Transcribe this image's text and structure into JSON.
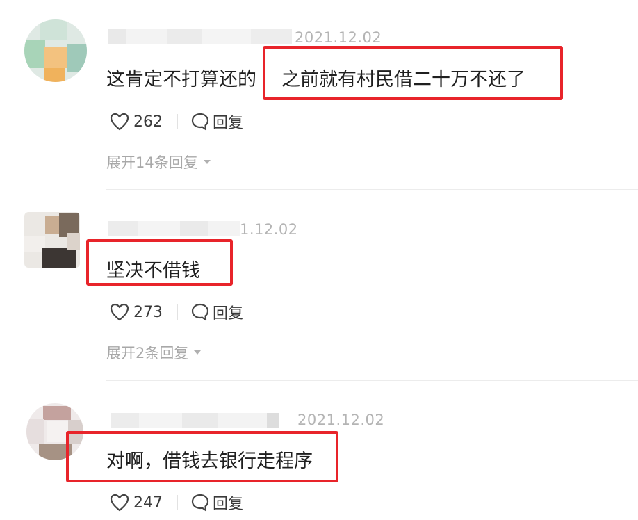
{
  "comments": [
    {
      "timestamp": "2021.12.02",
      "text_before": "这肯定不打算还的",
      "text_highlight": "之前就有村民借二十万不还了",
      "like_count": "262",
      "reply_label": "回复",
      "expand_label": "展开14条回复"
    },
    {
      "timestamp": "1.12.02",
      "text_highlight": "坚决不借钱",
      "like_count": "273",
      "reply_label": "回复",
      "expand_label": "展开2条回复"
    },
    {
      "timestamp": "2021.12.02",
      "text_highlight": "对啊，借钱去银行走程序",
      "like_count": "247",
      "reply_label": "回复"
    }
  ],
  "colors": {
    "highlight_border": "#e8242a",
    "secondary_text": "#b4b4b4"
  },
  "icons": [
    "heart-icon",
    "comment-bubble-icon",
    "chevron-down-icon"
  ]
}
